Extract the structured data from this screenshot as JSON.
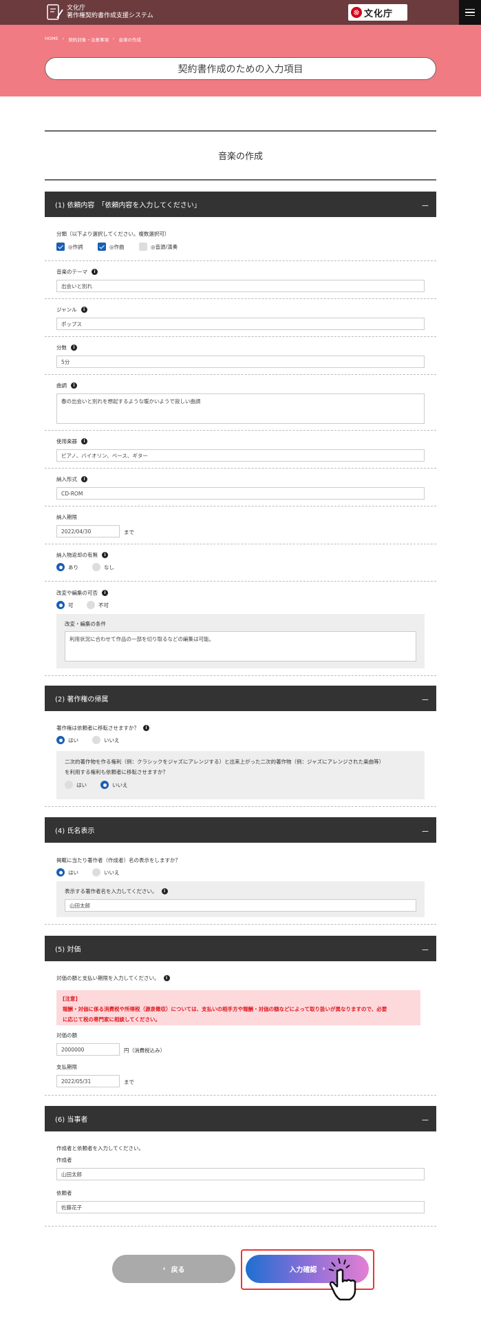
{
  "header": {
    "logo_line1": "文化庁",
    "logo_line2": "著作権契約書作成支援システム",
    "agency_badge": "文化庁",
    "menu_icon": "hamburger-icon"
  },
  "breadcrumb": [
    "HOME",
    "契約対象・注意事項",
    "音楽の作成"
  ],
  "page_title": "契約書作成のための入力項目",
  "section_title": "音楽の作成",
  "s1": {
    "title": "(1) 依頼内容　「依頼内容を入力してください」",
    "collapse": "－",
    "category_label": "分類（以下より選択してください。複数選択可）",
    "categories": [
      {
        "label": "◎作詞",
        "checked": true
      },
      {
        "label": "◎作曲",
        "checked": true
      },
      {
        "label": "◎音源/演奏",
        "checked": false
      }
    ],
    "theme_label": "音楽のテーマ",
    "theme_value": "出会いと別れ",
    "genre_label": "ジャンル",
    "genre_value": "ポップス",
    "length_label": "分数",
    "length_value": "5分",
    "tone_label": "曲調",
    "tone_value": "春の出会いと別れを想起するような暖かいようで寂しい曲調",
    "instruments_label": "使用楽器",
    "instruments_value": "ピアノ、バイオリン、ベース、ギター",
    "format_label": "納入形式",
    "format_value": "CD-ROM",
    "deadline_label": "納入期限",
    "deadline_value": "2022/04/30",
    "deadline_suffix": "まで",
    "return_label": "納入物返却の有無",
    "return_options": [
      {
        "label": "あり",
        "selected": true
      },
      {
        "label": "なし",
        "selected": false
      }
    ],
    "modify_label": "改変や編集の可否",
    "modify_options": [
      {
        "label": "可",
        "selected": true
      },
      {
        "label": "不可",
        "selected": false
      }
    ],
    "modify_cond_label": "改変・編集の条件",
    "modify_cond_value": "利用状況に合わせて作品の一部を切り取るなどの編集は可能。"
  },
  "s2": {
    "title": "(2) 著作権の帰属",
    "collapse": "－",
    "q1": "著作権は依頼者に移転させますか？",
    "q1_options": [
      {
        "label": "はい",
        "selected": true
      },
      {
        "label": "いいえ",
        "selected": false
      }
    ],
    "q2_line1": "二次的著作物を作る権利（例：クラシックをジャズにアレンジする）と出来上がった二次的著作物（例：ジャズにアレンジされた楽曲等）",
    "q2_line2": "を利用する権利も依頼者に移転させますか？",
    "q2_options": [
      {
        "label": "はい",
        "selected": false
      },
      {
        "label": "いいえ",
        "selected": true
      }
    ]
  },
  "s4": {
    "title": "(4) 氏名表示",
    "collapse": "－",
    "q": "掲載に当たり著作者（作成者）名の表示をしますか？",
    "options": [
      {
        "label": "はい",
        "selected": true
      },
      {
        "label": "いいえ",
        "selected": false
      }
    ],
    "name_label": "表示する著作者名を入力してください。",
    "name_value": "山田太郎"
  },
  "s5": {
    "title": "(5) 対価",
    "collapse": "－",
    "intro": "対価の額と支払い期限を入力してください。",
    "warn_title": "[注意]",
    "warn_line1": "報酬・対価に係る消費税や所得税（源泉徴収）については、支払いの相手方や報酬・対価の額などによって取り扱いが異なりますので、必要",
    "warn_line2": "に応じて税の専門家に相談してください。",
    "amount_label": "対価の額",
    "amount_value": "2000000",
    "amount_suffix": "円（消費税込み）",
    "pay_label": "支払期限",
    "pay_value": "2022/05/31",
    "pay_suffix": "まで"
  },
  "s6": {
    "title": "(6) 当事者",
    "collapse": "－",
    "intro": "作成者と依頼者を入力してください。",
    "creator_label": "作成者",
    "creator_value": "山田太郎",
    "client_label": "依頼者",
    "client_value": "佐藤花子"
  },
  "buttons": {
    "back": "戻る",
    "back_arrow": "‹",
    "next": "入力確認",
    "next_arrow": "›"
  },
  "colors": {
    "hero": "#f07b82",
    "header": "#6b3b3e",
    "accent": "#1a5fb4",
    "warn": "#e0191e"
  }
}
